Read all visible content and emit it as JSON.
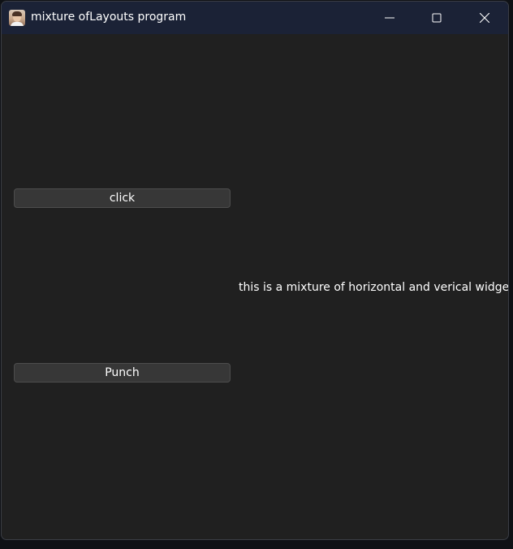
{
  "window": {
    "title": "mixture ofLayouts program",
    "controls": {
      "minimize_icon": "minimize-icon",
      "maximize_icon": "maximize-icon",
      "close_icon": "close-icon"
    }
  },
  "content": {
    "click_button_label": "click",
    "punch_button_label": "Punch",
    "info_label": "this is a mixture of horizontal and verical widgets"
  },
  "colors": {
    "titlebar": "#1b2236",
    "window_bg": "#202020",
    "button_bg": "#373737",
    "text": "#ffffff"
  }
}
